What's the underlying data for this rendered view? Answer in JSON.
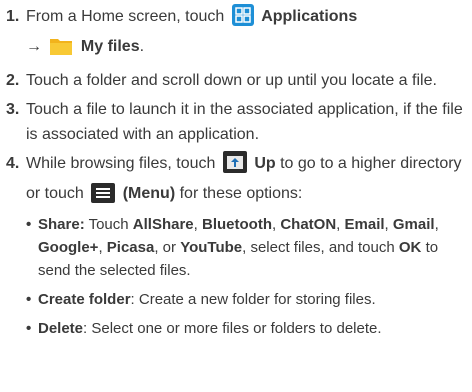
{
  "steps": [
    {
      "number": "1.",
      "text_a": "From a Home screen, touch",
      "icon_a": "applications-grid-icon",
      "bold_a": "Applications",
      "arrow": "→",
      "icon_b": "folder-icon",
      "bold_b": "My files",
      "end": "."
    },
    {
      "number": "2.",
      "text": "Touch a folder and scroll down or up until you locate a file."
    },
    {
      "number": "3.",
      "text": "Touch a file to launch it in the associated application, if the file is associated with an application."
    },
    {
      "number": "4.",
      "text_a": "While browsing files, touch",
      "icon_up": "up-folder-icon",
      "bold_up": "Up",
      "text_b": "to go to a higher directory or touch",
      "icon_menu": "menu-icon",
      "bold_menu": "(Menu)",
      "text_c": "for these options:",
      "bullets": {
        "share": {
          "label": "Share:",
          "t1": "Touch",
          "b_allshare": "AllShare",
          "b_bluetooth": "Bluetooth",
          "b_chaton": "ChatON",
          "b_email": "Email",
          "b_gmail": "Gmail",
          "b_googleplus": "Google+",
          "b_picasa": "Picasa",
          "t_or": ", or",
          "b_youtube": "YouTube",
          "t2": ", select files, and touch",
          "b_ok": "OK",
          "t3": "to send the selected files."
        },
        "create_folder": {
          "label": "Create folder",
          "text": ": Create a new folder for storing files."
        },
        "delete": {
          "label": "Delete",
          "text": ": Select one or more files or folders to delete."
        }
      }
    }
  ],
  "colors": {
    "text": "#3a3a3a",
    "app_icon_bg": "#1e8fd6",
    "folder": "#f2b31c",
    "icon_dark": "#2b2b2b"
  }
}
